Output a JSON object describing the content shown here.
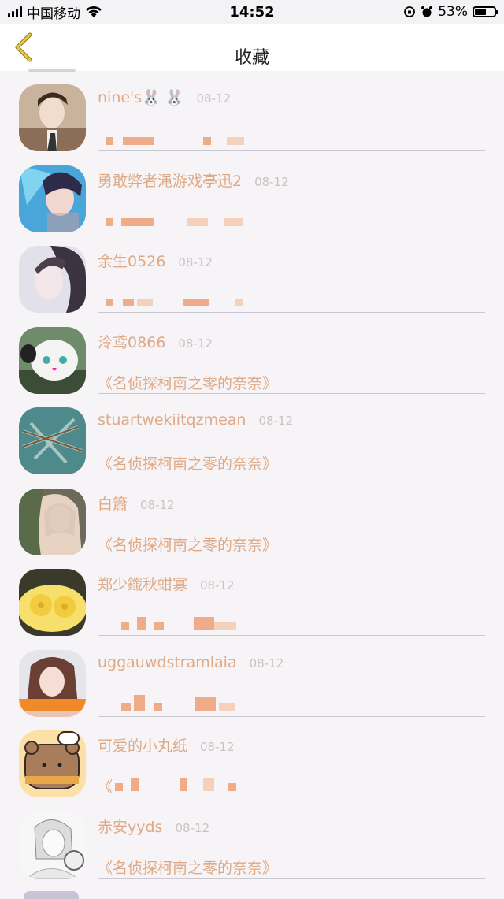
{
  "status_bar": {
    "carrier": "中国移动",
    "time": "14:52",
    "battery": "53%"
  },
  "nav": {
    "title": "收藏",
    "back_icon": "chevron-left-icon",
    "accent": "#e8c84a"
  },
  "colors": {
    "name": "#e0a985",
    "date": "#c9c3c3",
    "divider": "#c9c7cf"
  },
  "items": [
    {
      "name": "nine's🐰 🐰",
      "date": "08-12",
      "content": "",
      "avatar": "portrait-man-icon"
    },
    {
      "name": "勇敢弊者渑游戏亭迅2",
      "date": "08-12",
      "content": "",
      "avatar": "anime-boy-icon"
    },
    {
      "name": "余生0526",
      "date": "08-12",
      "content": "",
      "avatar": "girl-portrait-icon"
    },
    {
      "name": "泠鸢0866",
      "date": "08-12",
      "content": "《名侦探柯南之零的奈奈》",
      "avatar": "white-cat-icon"
    },
    {
      "name": "stuartwekiitqzmean",
      "date": "08-12",
      "content": "《名侦探柯南之零的奈奈》",
      "avatar": "teal-art-icon"
    },
    {
      "name": "白簫",
      "date": "08-12",
      "content": "《名侦探柯南之零的奈奈》",
      "avatar": "blonde-girl-icon"
    },
    {
      "name": "郑少鑯秋蚶寡",
      "date": "08-12",
      "content": "",
      "avatar": "donuts-icon"
    },
    {
      "name": "uggauwdstramlaia",
      "date": "08-12",
      "content": "",
      "avatar": "selfie-girl-icon"
    },
    {
      "name": "可爱的小丸纸",
      "date": "08-12",
      "content": "《",
      "avatar": "cartoon-bear-icon"
    },
    {
      "name": "赤安yyds",
      "date": "08-12",
      "content": "《名侦探柯南之零的奈奈》",
      "avatar": "sketch-boy-icon"
    }
  ]
}
